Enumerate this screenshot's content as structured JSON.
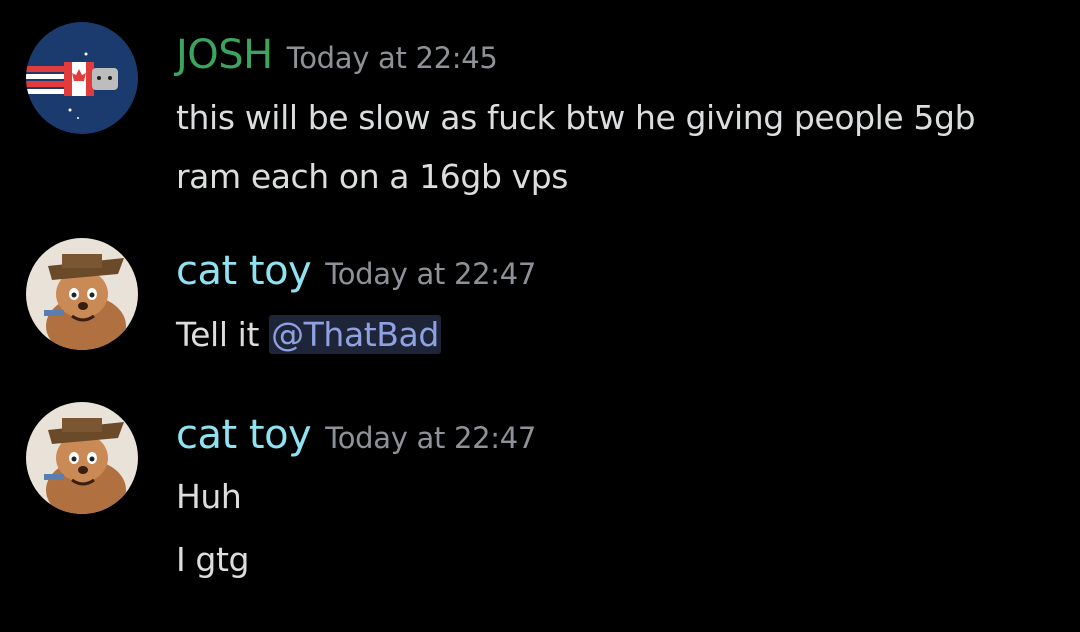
{
  "messages": [
    {
      "author": "JOSH",
      "author_color": "#3ba55d",
      "timestamp": "Today at 22:45",
      "avatar": "flag-nyan-cat-avatar",
      "lines": [
        "this will be slow as fuck btw he giving people 5gb",
        "ram each on a 16gb vps"
      ]
    },
    {
      "author": "cat toy",
      "author_color": "#8fe3f1",
      "timestamp": "Today at 22:47",
      "avatar": "cartoon-mouse-hat-avatar",
      "lines": [
        "Tell it "
      ],
      "mention": "@ThatBad"
    },
    {
      "author": "cat toy",
      "author_color": "#8fe3f1",
      "timestamp": "Today at 22:47",
      "avatar": "cartoon-mouse-hat-avatar",
      "lines": [
        "Huh",
        "I gtg"
      ]
    }
  ]
}
